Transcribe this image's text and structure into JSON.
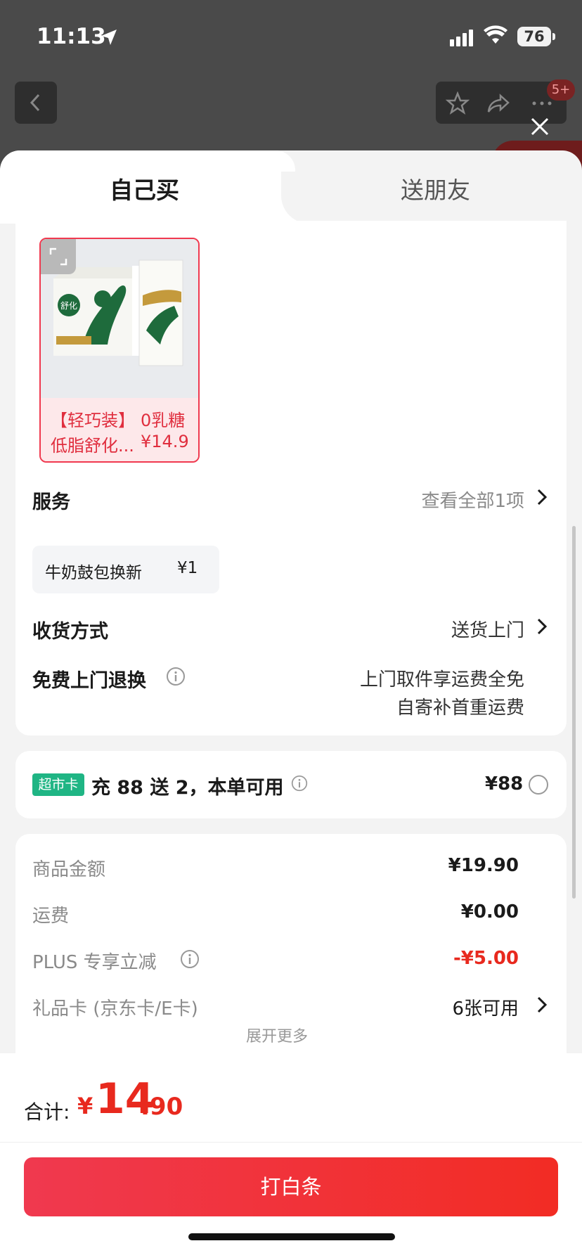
{
  "status_bar": {
    "time": "11:13",
    "battery": "76"
  },
  "background": {
    "badge": "5+"
  },
  "tabs": [
    {
      "label": "自己买"
    },
    {
      "label": "送朋友"
    }
  ],
  "product": {
    "caption_line1_left": "【轻巧装】",
    "caption_line1_right": "0乳糖",
    "caption_line2_left": "低脂舒化...",
    "caption_line2_right": "¥14.9",
    "brand_text": "舒化"
  },
  "service": {
    "label": "服务",
    "view_all": "查看全部1项",
    "chip_name": "牛奶鼓包换新",
    "chip_price": "¥1"
  },
  "delivery": {
    "label": "收货方式",
    "value": "送货上门"
  },
  "free_return": {
    "label": "免费上门退换",
    "line1": "上门取件享运费全免",
    "line2": "自寄补首重运费"
  },
  "supermarket_card": {
    "tag": "超市卡",
    "text": "充 88 送 2，本单可用",
    "price": "¥88"
  },
  "fees": {
    "items": [
      {
        "label": "商品金额",
        "value": "¥19.90"
      },
      {
        "label": "运费",
        "value": "¥0.00"
      },
      {
        "label": "PLUS 专享立减",
        "value": "-¥5.00"
      },
      {
        "label": "礼品卡 (京东卡/E卡)",
        "value": "6张可用"
      }
    ],
    "expand_more": "展开更多"
  },
  "total": {
    "label": "合计:",
    "symbol": "¥",
    "integer": "14",
    "decimal": ".90"
  },
  "pay_button": "打白条",
  "colors": {
    "accent_red": "#e8291e",
    "tag_green": "#1fb584",
    "border_red": "#f0394f"
  }
}
